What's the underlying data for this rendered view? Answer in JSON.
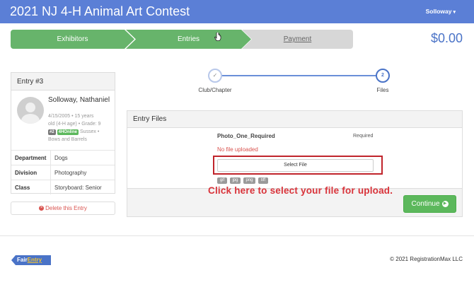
{
  "header": {
    "title": "2021 NJ 4-H Animal Art Contest",
    "user": "Solloway",
    "caret": "▾"
  },
  "steps": {
    "exhibitors": "Exhibitors",
    "entries": "Entries",
    "payment": "Payment"
  },
  "total": "$0.00",
  "entry_card": {
    "title": "Entry #3",
    "name": "Solloway, Nathaniel",
    "birth": "4/15/2005 • 15 years",
    "age_line": "old (4-H age) • Grade: 9",
    "badge_num": "#2",
    "badge_online": "4HOnline",
    "county": "Sussex •",
    "club": "Bows and Barrels",
    "rows": [
      {
        "label": "Department",
        "value": "Dogs"
      },
      {
        "label": "Division",
        "value": "Photography"
      },
      {
        "label": "Class",
        "value": "Storyboard: Senior"
      }
    ],
    "delete_label": "Delete this Entry",
    "delete_icon": "×"
  },
  "progress": {
    "step1_label": "Club/Chapter",
    "step1_icon": "✓",
    "step2_number": "2",
    "step2_label": "Files"
  },
  "files": {
    "title": "Entry Files",
    "field_name": "Photo_One_Required",
    "required": "Required",
    "status": "No file uploaded",
    "select_label": "Select File",
    "types": [
      "gif",
      "jpg",
      "png",
      "tiff"
    ]
  },
  "annotation": "Click here to select your file for upload.",
  "continue_label": "Continue",
  "continue_icon": "▶",
  "footer": {
    "logo_part1": "Fair",
    "logo_part2": "Entry",
    "copyright": "© 2021 RegistrationMax LLC"
  },
  "colors": {
    "header": "#5b7fd6",
    "step_done": "#67b46b",
    "step_pending": "#d7d7d7",
    "accent": "#4a73c7",
    "danger": "#d9534f",
    "success": "#5cb85c"
  }
}
